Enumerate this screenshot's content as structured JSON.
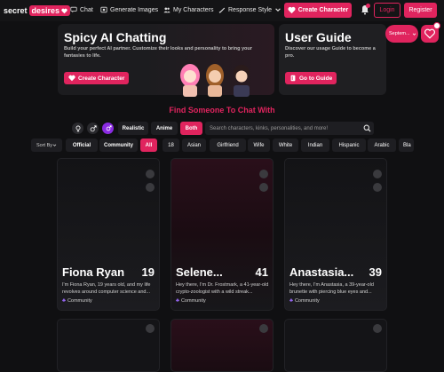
{
  "brand": {
    "word1": "secret",
    "word2": "desires"
  },
  "nav": {
    "chat": "Chat",
    "generate": "Generate Images",
    "my_characters": "My Characters",
    "response_style": "Response Style",
    "create_character": "Create Character",
    "login": "Login",
    "register": "Register"
  },
  "banners": {
    "spicy": {
      "title": "Spicy AI Chatting",
      "text": "Build your perfect AI partner. Customize their looks and personality to bring your fantasies to life.",
      "button": "Create Character"
    },
    "guide": {
      "title": "User Guide",
      "text": "Discover our usage Guide to become a pro.",
      "button": "Go to Guide"
    }
  },
  "side_pill": "Septem...",
  "section_title": "Find Someone To Chat With",
  "styles": [
    "Realistic",
    "Anime",
    "Both"
  ],
  "search": {
    "placeholder": "Search characters, kinks, personalities, and more!"
  },
  "sort_by": "Sort By",
  "filters": [
    "Official",
    "Community",
    "All",
    "18",
    "Asian",
    "Girlfriend",
    "Wife",
    "White",
    "Indian",
    "Hispanic",
    "Arabic",
    "Bla"
  ],
  "cards": [
    {
      "name": "Fiona Ryan",
      "age": "19",
      "desc": "I'm Fiona Ryan, 19 years old, and my life revolves around computer science and...",
      "tag": "Community"
    },
    {
      "name": "Selene...",
      "age": "41",
      "desc": "Hey there, I'm Dr. Frostmark, a 41-year-old crypto-zoologist with a wild streak...",
      "tag": "Community"
    },
    {
      "name": "Anastasia...",
      "age": "39",
      "desc": "Hey there, I'm Anastasia, a 39-year-old brunette with piercing blue eyes and...",
      "tag": "Community"
    }
  ],
  "colors": {
    "accent": "#e0245e",
    "purple": "#8a2be2",
    "bg": "#101012"
  }
}
